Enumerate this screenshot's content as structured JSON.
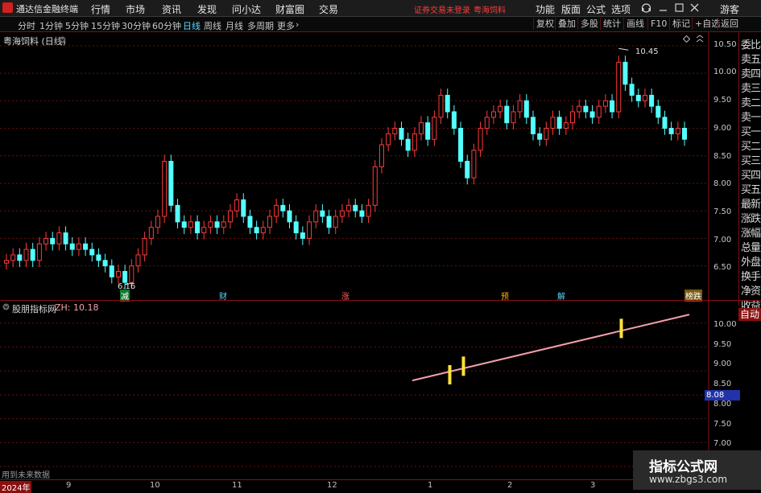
{
  "app": {
    "title": "通达信金融终端"
  },
  "menu": [
    "行情",
    "市场",
    "资讯",
    "发现",
    "问小达",
    "财富圈",
    "交易"
  ],
  "notice": {
    "login": "证券交易未登录",
    "stock": "粤海饲料"
  },
  "menu_right": [
    "功能",
    "版面",
    "公式",
    "选项"
  ],
  "user": "游客",
  "periods": [
    "分时",
    "1分钟",
    "5分钟",
    "15分钟",
    "30分钟",
    "60分钟",
    "日线",
    "周线",
    "月线",
    "多周期",
    "更多"
  ],
  "active_period": "日线",
  "toolbar": [
    "复权",
    "叠加",
    "多股",
    "统计",
    "画线",
    "F10",
    "标记",
    "+自选",
    "返回"
  ],
  "main_chart": {
    "title": "粤海饲料 (日线)",
    "high_label": "10.45",
    "low_label": "6.16",
    "y_ticks": [
      "10.50",
      "10.00",
      "9.50",
      "9.00",
      "8.50",
      "8.00",
      "7.50",
      "7.00",
      "6.50"
    ],
    "event_markers": [
      "减",
      "财",
      "涨",
      "预",
      "解",
      "榜跌"
    ]
  },
  "side_panel": [
    "委比",
    "卖五",
    "卖四",
    "卖三",
    "卖二",
    "卖一",
    "买一",
    "买二",
    "买三",
    "买四",
    "买五",
    "最新",
    "涨跌",
    "涨幅",
    "总量",
    "外盘",
    "换手",
    "净资",
    "收益"
  ],
  "sub_chart": {
    "name": "股朋指标网",
    "zh_label": "ZH: 10.18",
    "auto_button": "自动",
    "y_ticks": [
      "10.00",
      "9.50",
      "9.00",
      "8.50",
      "8.00",
      "7.50",
      "7.00"
    ],
    "current_value": "8.08",
    "note": "用到未来数据"
  },
  "x_axis": [
    "2024年",
    "9",
    "10",
    "11",
    "12",
    "1",
    "2",
    "3"
  ],
  "watermark": {
    "line1": "指标公式网",
    "line2": "www.zbgs3.com"
  },
  "colors": {
    "up": "#ff3b3b",
    "down": "#54ffff",
    "line": "#f2a0a8",
    "marker": "#ffe23a",
    "grid": "#6b0f0f"
  },
  "chart_data": {
    "type": "candlestick",
    "ylim": [
      6.1,
      10.6
    ],
    "high": 10.45,
    "low": 6.16,
    "close_series": [
      6.6,
      6.7,
      6.6,
      6.8,
      6.6,
      6.9,
      7.0,
      6.9,
      7.1,
      6.9,
      6.8,
      6.9,
      6.8,
      6.7,
      6.6,
      6.5,
      6.3,
      6.4,
      6.2,
      6.5,
      6.7,
      7.0,
      7.2,
      7.4,
      8.4,
      7.6,
      7.3,
      7.2,
      7.3,
      7.1,
      7.2,
      7.3,
      7.2,
      7.3,
      7.5,
      7.7,
      7.4,
      7.2,
      7.1,
      7.2,
      7.4,
      7.6,
      7.5,
      7.3,
      7.1,
      7.0,
      7.3,
      7.5,
      7.4,
      7.2,
      7.4,
      7.5,
      7.6,
      7.5,
      7.4,
      7.6,
      8.3,
      8.7,
      8.9,
      9.0,
      8.8,
      8.6,
      8.9,
      9.1,
      8.8,
      9.2,
      9.6,
      9.3,
      9.0,
      8.4,
      8.1,
      8.6,
      9.0,
      9.2,
      9.3,
      9.4,
      9.1,
      9.3,
      9.5,
      9.2,
      8.9,
      8.8,
      9.0,
      9.2,
      9.0,
      9.1,
      9.3,
      9.4,
      9.3,
      9.2,
      9.4,
      9.5,
      9.3,
      10.2,
      9.8,
      9.6,
      9.5,
      9.6,
      9.4,
      9.2,
      9.0,
      8.9,
      9.0,
      8.8
    ]
  },
  "indicator_data": {
    "type": "line",
    "ylim": [
      6.9,
      10.3
    ],
    "start": 8.8,
    "end": 10.18,
    "markers": [
      8.92,
      9.1,
      9.89
    ]
  }
}
